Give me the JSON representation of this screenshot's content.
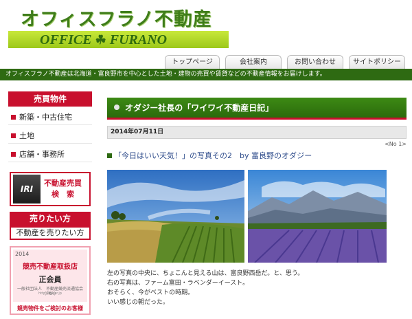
{
  "header": {
    "logo_jp": "オフィスフラノ不動産",
    "logo_en_left": "OFFICE",
    "logo_en_right": "FURANO"
  },
  "nav": {
    "tabs": [
      "トップページ",
      "会社案内",
      "お問い合わせ",
      "サイトポリシー"
    ]
  },
  "tagline": "オフィスフラノ不動産は北海道・富良野市を中心とした土地・建物の売買や賃貸などの不動産情報をお届けします。",
  "sidebar": {
    "section_title": "売買物件",
    "items": [
      {
        "label": "新築・中古住宅"
      },
      {
        "label": "土地"
      },
      {
        "label": "店舗・事務所"
      }
    ],
    "search_banner": {
      "logo_text": "IRI",
      "line1": "不動産売買",
      "line2": "検　索"
    },
    "sell_title": "売りたい方",
    "sell_button": "不動産を売りたい方",
    "badge": {
      "year": "2014",
      "title": "競売不動産取扱店",
      "member": "正会員",
      "org": "一般社団法人　不動産競売流通協会 (FKR)",
      "url": "http://fkr.or.jp",
      "caption": "競売物件をご検討のお客様"
    }
  },
  "main": {
    "section_title": "オダジー社長の「ワイワイ不動産日記」",
    "date": "2014年07月11日",
    "pager": "<No 1>",
    "post_title": "「今日はいい天気！」の写真その2　by 富良野のオダジー",
    "photos": [
      {
        "alt": "富良野西岳と畑の風景",
        "icon": "landscape-field"
      },
      {
        "alt": "ラベンダー畑と山の風景",
        "icon": "landscape-lavender"
      }
    ],
    "body_lines": [
      "左の写真の中央に、ちょこんと見える山は、富良野西岳だ。と、思う。",
      "右の写真は、ファーム富田・ラベンダーイースト。",
      "おそらく、今がベストの時期。",
      "いい感じの朝だった。"
    ]
  },
  "colors": {
    "brand_green": "#2e6a12",
    "accent_red": "#c8102e",
    "logo_bar": "#b4dc28"
  }
}
